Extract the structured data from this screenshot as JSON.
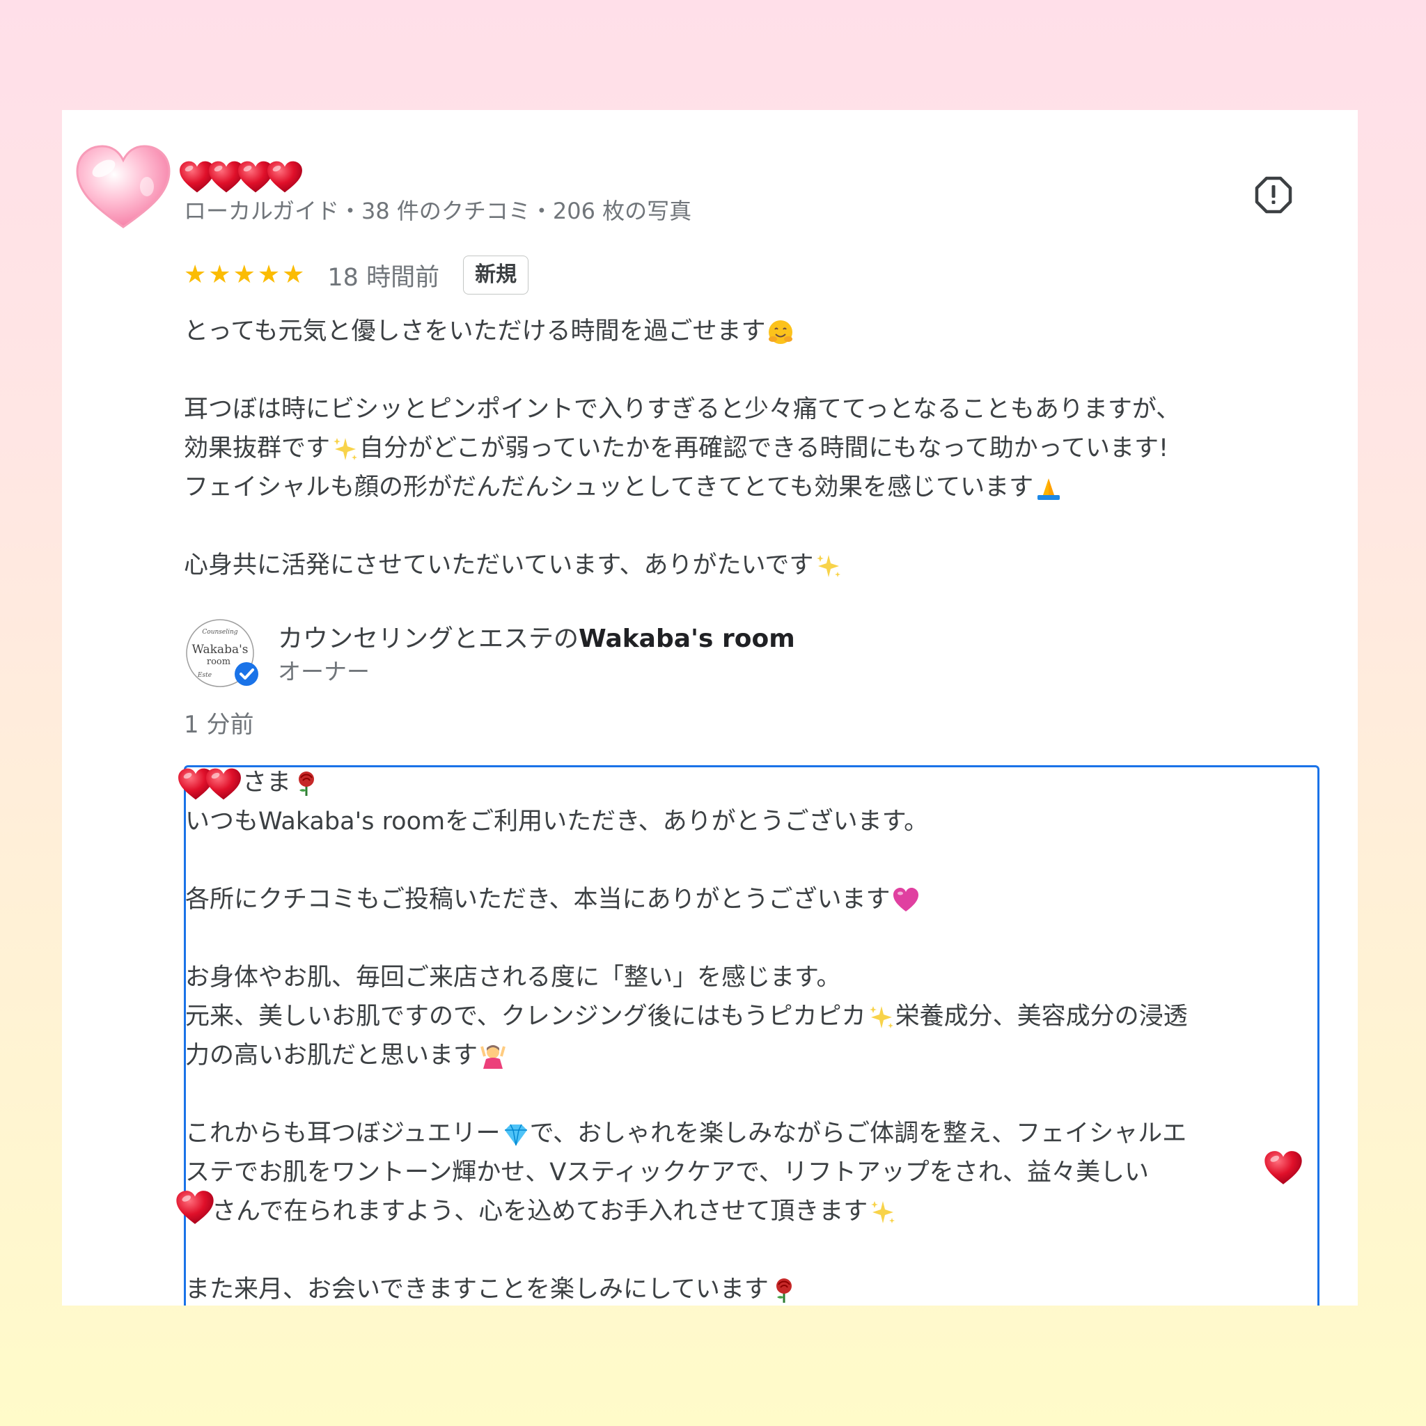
{
  "reviewer": {
    "meta": "ローカルガイド・38 件のクチコミ・206 枚の写真",
    "rating_stars": 5,
    "time": "18 時間前",
    "badge": "新規"
  },
  "review": {
    "line1": "とっても元気と優しさをいただける時間を過ごせます",
    "line2": "耳つぼは時にビシッとピンポイントで入りすぎると少々痛ててっとなることもありますが、",
    "line3a": "効果抜群です",
    "line3b": "自分がどこが弱っていたかを再確認できる時間にもなって助かっています!",
    "line4": "フェイシャルも顔の形がだんだんシュッとしてきてとても効果を感じています",
    "line5": "心身共に活発にさせていただいています、ありがたいです"
  },
  "owner": {
    "name_prefix": "カウンセリングとエステの",
    "name_brand": "Wakaba's room",
    "role": "オーナー",
    "reply_time": "1 分前",
    "logo_top": "Counseling",
    "logo_main1": "Wakaba's",
    "logo_main2": "room",
    "logo_bottom": "Este"
  },
  "reply": {
    "l1": "さま",
    "l2": "いつもWakaba's roomをご利用いただき、ありがとうございます。",
    "l3": "各所にクチコミもご投稿いただき、本当にありがとうございます",
    "l4": "お身体やお肌、毎回ご来店される度に「整い」を感じます。",
    "l5a": "元来、美しいお肌ですので、クレンジング後にはもうピカピカ",
    "l5b": "栄養成分、美容成分の浸透",
    "l6": "力の高いお肌だと思います",
    "l7a": "これからも耳つぼジュエリー",
    "l7b": "で、おしゃれを楽しみながらご体調を整え、フェイシャルエ",
    "l8": "ステでお肌をワントーン輝かせ、Vスティックケアで、リフトアップをされ、益々美しい",
    "l9": "さんで在られますよう、心を込めてお手入れさせて頂きます",
    "l10": "また来月、お会いできますことを楽しみにしています"
  },
  "colors": {
    "star": "#fbbc04",
    "reply_border": "#1a73e8",
    "verified": "#1a73e8",
    "heart": "#e3152e"
  }
}
